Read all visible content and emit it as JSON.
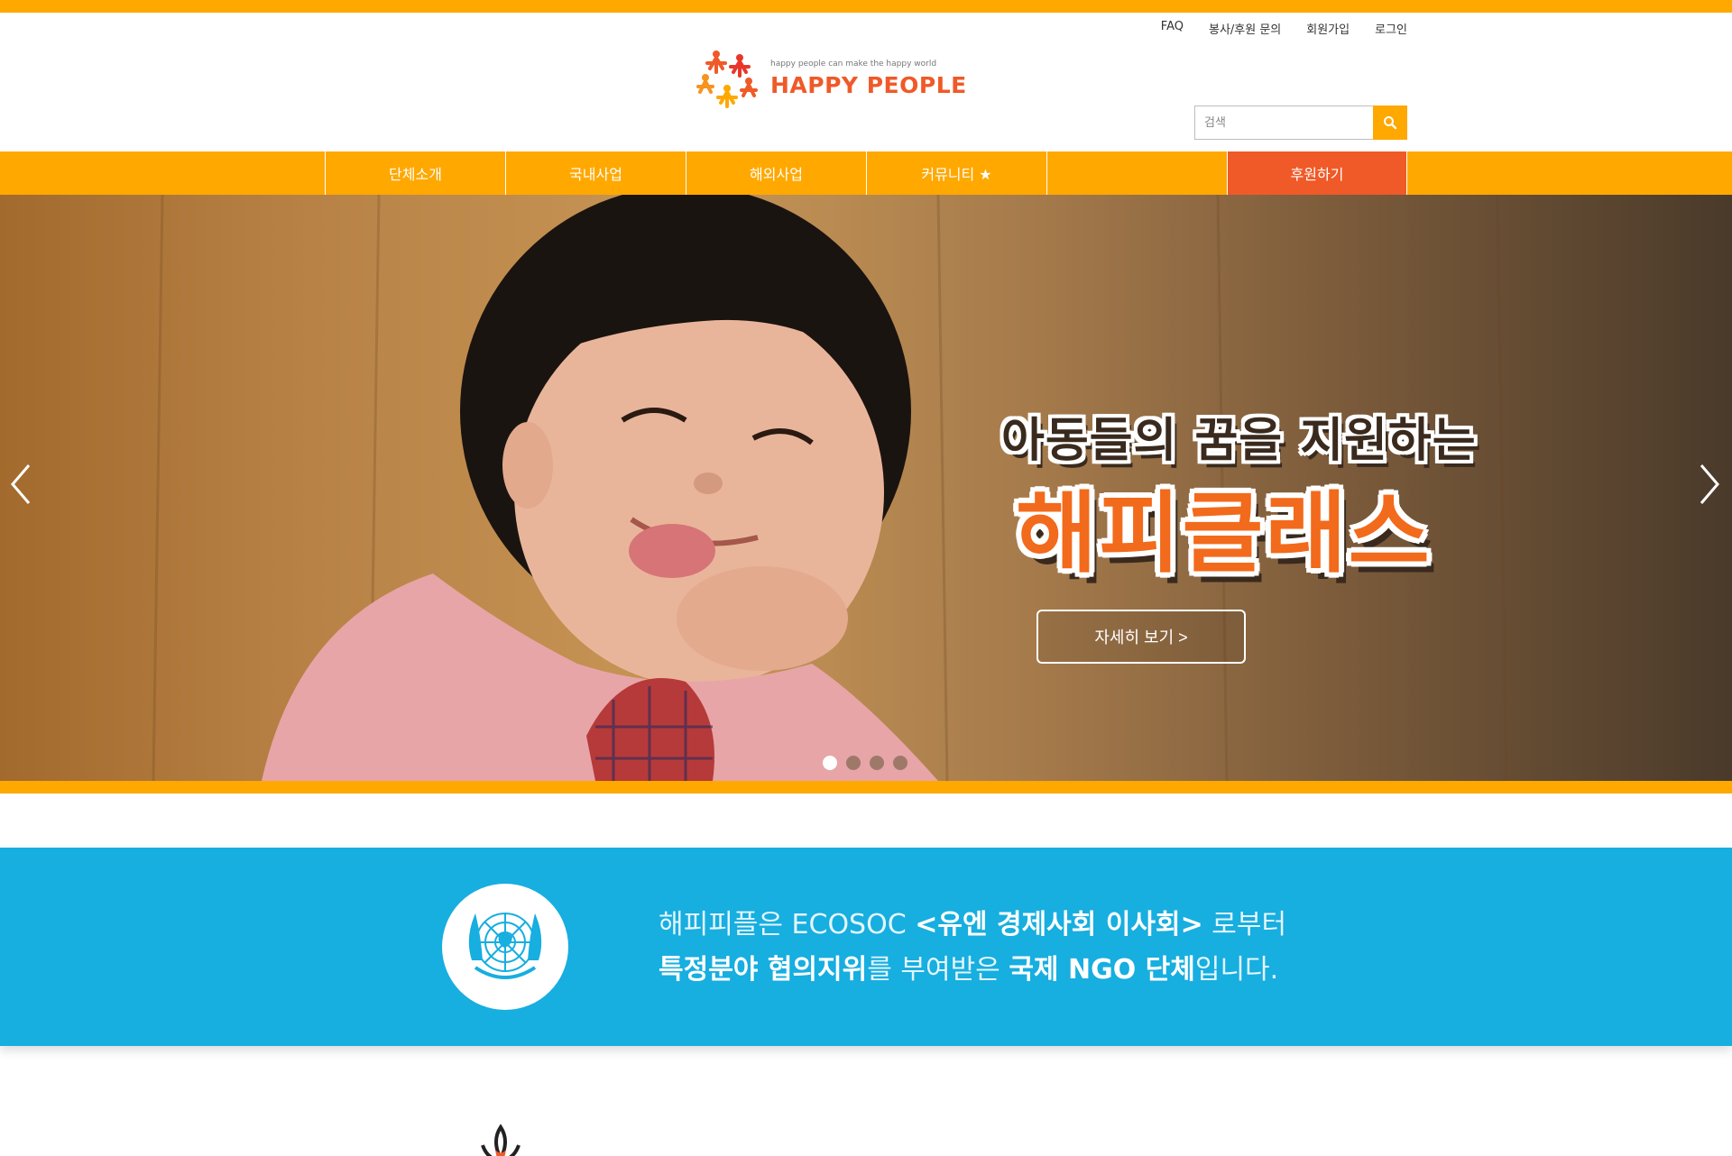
{
  "header": {
    "util_links": [
      {
        "label": "FAQ"
      },
      {
        "label": "봉사/후원 문의"
      },
      {
        "label": "회원가입"
      },
      {
        "label": "로그인"
      }
    ],
    "logo": {
      "tagline": "happy people can make the happy world",
      "name": "HAPPY PEOPLE"
    },
    "search": {
      "placeholder": "검색",
      "icon": "search-icon"
    }
  },
  "nav": {
    "items": [
      {
        "label": "단체소개"
      },
      {
        "label": "국내사업"
      },
      {
        "label": "해외사업"
      },
      {
        "label": "커뮤니티 ★"
      },
      {
        "label": ""
      },
      {
        "label": "후원하기"
      }
    ]
  },
  "hero": {
    "subtitle": "아동들의 꿈을 지원하는",
    "title": "해피클래스",
    "button_label": "자세히 보기 >",
    "prev_icon": "chevron-left-icon",
    "next_icon": "chevron-right-icon",
    "slide_count": 4,
    "active_slide": 1
  },
  "un_band": {
    "line1_a": "해피피플은 ECOSOC ",
    "line1_b": "<유엔 경제사회 이사회>",
    "line1_c": " 로부터",
    "line2_a": "특정분야 협의지위",
    "line2_b": "를 부여받은 ",
    "line2_c": "국제 NGO 단체",
    "line2_d": "입니다.",
    "icon": "un-emblem-icon"
  },
  "colors": {
    "accent": "#ffa800",
    "donate": "#ef5a28",
    "band": "#17aee0"
  }
}
